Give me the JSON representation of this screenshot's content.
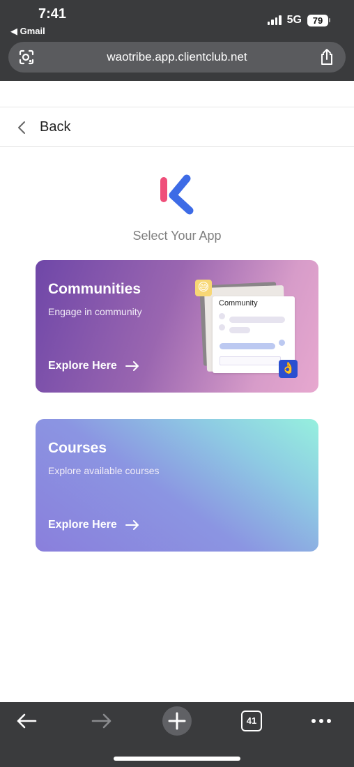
{
  "status_bar": {
    "time": "7:41",
    "back_app": "◀ Gmail",
    "network": "5G",
    "battery": "79"
  },
  "browser": {
    "url": "waotribe.app.clientclub.net",
    "tab_count": "41"
  },
  "page": {
    "back_label": "Back",
    "select_title": "Select Your App",
    "cards": [
      {
        "title": "Communities",
        "description": "Engage in community",
        "cta": "Explore Here",
        "illustration_label": "Community"
      },
      {
        "title": "Courses",
        "description": "Explore available courses",
        "cta": "Explore Here"
      }
    ]
  },
  "icons": {
    "lens": "lens-icon",
    "share": "share-icon",
    "back_chevron": "chevron-left-icon",
    "arrow": "arrow-right-icon",
    "toolbar_back": "arrow-left-icon",
    "toolbar_forward": "arrow-right-icon",
    "new_tab": "plus-icon",
    "tabs": "tabs-icon",
    "more": "more-icon",
    "emoji_a": "😅",
    "emoji_b": "👌"
  },
  "colors": {
    "chrome": "#3a3b3d",
    "logo_pink": "#ef4f7a",
    "logo_blue": "#3d6be6"
  }
}
